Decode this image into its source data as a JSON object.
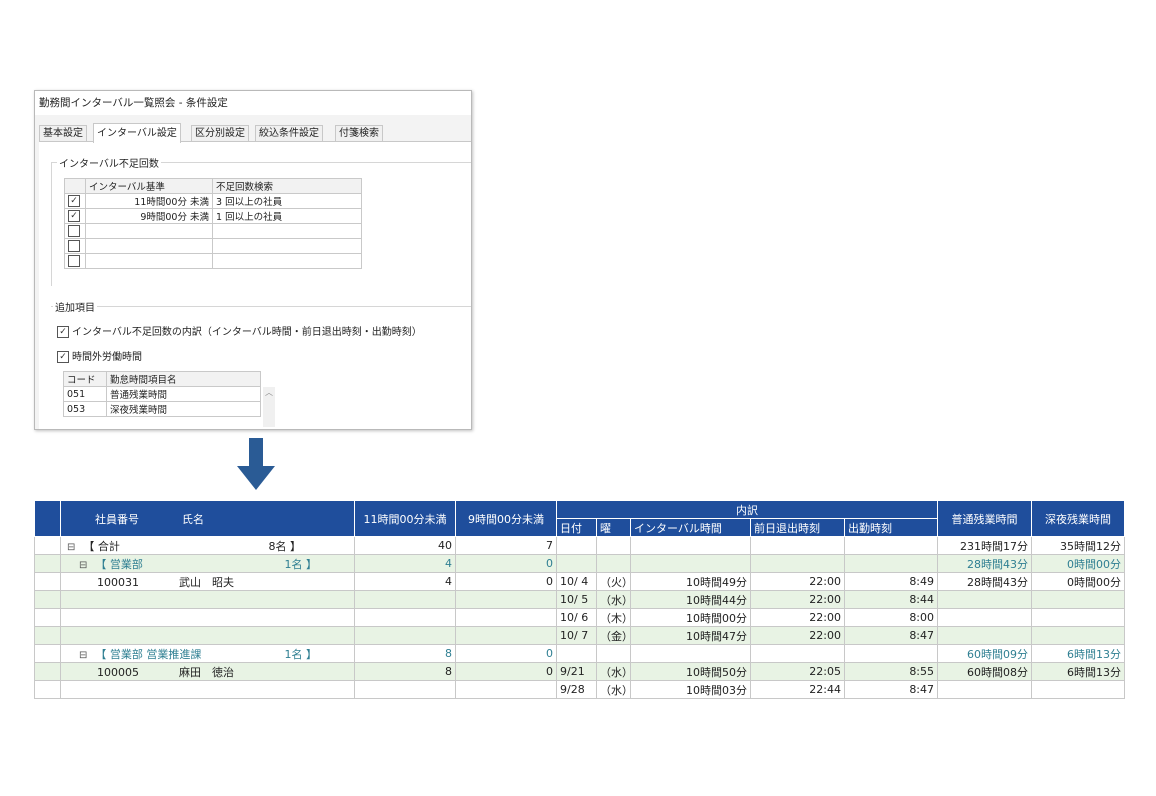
{
  "dialog": {
    "title": "勤務間インターバル一覧照会 - 条件設定",
    "tabs": [
      "基本設定",
      "インターバル設定",
      "区分別設定",
      "絞込条件設定",
      "付箋検索"
    ],
    "active_tab": 1,
    "interval_group": {
      "label": "インターバル不足回数",
      "headers": [
        "インターバル基準",
        "不足回数検索"
      ],
      "rows": [
        {
          "checked": true,
          "standard": "11時間00分 未満",
          "search": "3 回以上の社員"
        },
        {
          "checked": true,
          "standard": "9時間00分 未満",
          "search": "1 回以上の社員"
        },
        {
          "checked": false,
          "standard": "",
          "search": ""
        },
        {
          "checked": false,
          "standard": "",
          "search": ""
        },
        {
          "checked": false,
          "standard": "",
          "search": ""
        }
      ]
    },
    "extra_group": {
      "label": "追加項目",
      "option1": "インターバル不足回数の内訳（インターバル時間・前日退出時刻・出勤時刻）",
      "option2": "時間外労働時間",
      "headers": [
        "コード",
        "勤怠時間項目名"
      ],
      "rows": [
        {
          "code": "051",
          "name": "普通残業時間"
        },
        {
          "code": "053",
          "name": "深夜残業時間"
        }
      ]
    }
  },
  "report": {
    "headers": {
      "emp_no": "社員番号",
      "name": "氏名",
      "h11": "11時間00分未満",
      "h9": "9時間00分未満",
      "detail": "内訳",
      "date": "日付",
      "dow": "曜",
      "interval": "インターバル時間",
      "prev_exit": "前日退出時刻",
      "start": "出勤時刻",
      "ot_normal": "普通残業時間",
      "ot_night": "深夜残業時間"
    },
    "rows": [
      {
        "type": "total",
        "label": "【 合計",
        "count": "8名 】",
        "h11": "40",
        "h9": "7",
        "date": "",
        "dow": "",
        "interval": "",
        "prev": "",
        "start": "",
        "ot1": "231時間17分",
        "ot2": "35時間12分"
      },
      {
        "type": "dept",
        "label": "【 営業部",
        "count": "1名 】",
        "h11": "4",
        "h9": "0",
        "date": "",
        "dow": "",
        "interval": "",
        "prev": "",
        "start": "",
        "ot1": "28時間43分",
        "ot2": "0時間00分"
      },
      {
        "type": "emp",
        "emp_no": "100031",
        "name": "武山　昭夫",
        "h11": "4",
        "h9": "0",
        "date": "10/ 4",
        "dow": "（火）",
        "interval": "10時間49分",
        "prev": "22:00",
        "start": "8:49",
        "ot1": "28時間43分",
        "ot2": "0時間00分"
      },
      {
        "type": "detail",
        "date": "10/ 5",
        "dow": "（水）",
        "interval": "10時間44分",
        "prev": "22:00",
        "start": "8:44"
      },
      {
        "type": "detail",
        "date": "10/ 6",
        "dow": "（木）",
        "interval": "10時間00分",
        "prev": "22:00",
        "start": "8:00"
      },
      {
        "type": "detail",
        "date": "10/ 7",
        "dow": "（金）",
        "interval": "10時間47分",
        "prev": "22:00",
        "start": "8:47"
      },
      {
        "type": "dept",
        "label": "【 営業部 営業推進課",
        "count": "1名 】",
        "h11": "8",
        "h9": "0",
        "date": "",
        "dow": "",
        "interval": "",
        "prev": "",
        "start": "",
        "ot1": "60時間09分",
        "ot2": "6時間13分"
      },
      {
        "type": "emp",
        "emp_no": "100005",
        "name": "麻田　徳治",
        "h11": "8",
        "h9": "0",
        "date": "9/21",
        "dow": "（水）",
        "interval": "10時間50分",
        "prev": "22:05",
        "start": "8:55",
        "ot1": "60時間08分",
        "ot2": "6時間13分"
      },
      {
        "type": "detail",
        "date": "9/28",
        "dow": "（水）",
        "interval": "10時間03分",
        "prev": "22:44",
        "start": "8:47"
      }
    ]
  },
  "colors": {
    "header_blue": "#1f4e9c",
    "row_green": "#e8f3e4",
    "dept_text": "#2f7f92",
    "arrow": "#2a5b95"
  },
  "icons": {
    "collapse": "minus-box-icon",
    "check": "checkbox-icon",
    "arrow": "down-arrow-icon"
  }
}
